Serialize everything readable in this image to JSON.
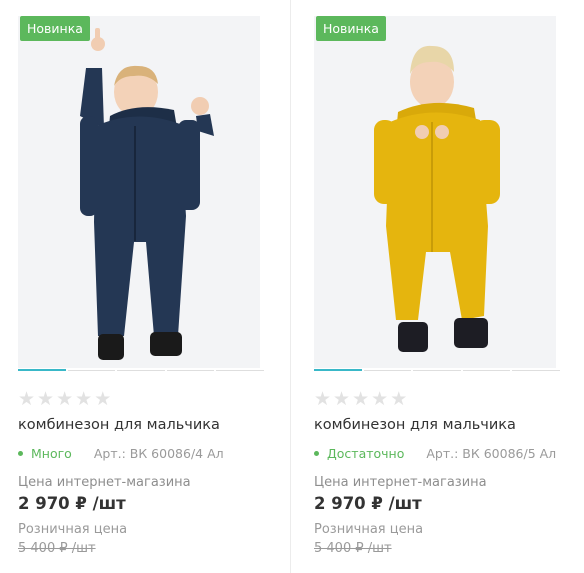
{
  "products": [
    {
      "badge": "Новинка",
      "title": "комбинезон для мальчика",
      "stock": "Много",
      "article": "Арт.: ВК 60086/4 Ал",
      "price_label": "Цена интернет-магазина",
      "price": "2 970 ₽ /шт",
      "retail_label": "Розничная цена",
      "retail_price": "5 400 ₽ /шт",
      "rating_stars": 5,
      "garment_color": "#243754",
      "gallery_slides": 5
    },
    {
      "badge": "Новинка",
      "title": "комбинезон для мальчика",
      "stock": "Достаточно",
      "article": "Арт.: ВК 60086/5 Ал",
      "price_label": "Цена интернет-магазина",
      "price": "2 970 ₽ /шт",
      "retail_label": "Розничная цена",
      "retail_price": "5 400 ₽ /шт",
      "rating_stars": 5,
      "garment_color": "#e5b50e",
      "gallery_slides": 5
    }
  ],
  "colors": {
    "badge": "#5cb85c",
    "stock": "#5cb85c",
    "gallery_active": "#39b8c8",
    "star_empty": "#e2e2e2"
  }
}
